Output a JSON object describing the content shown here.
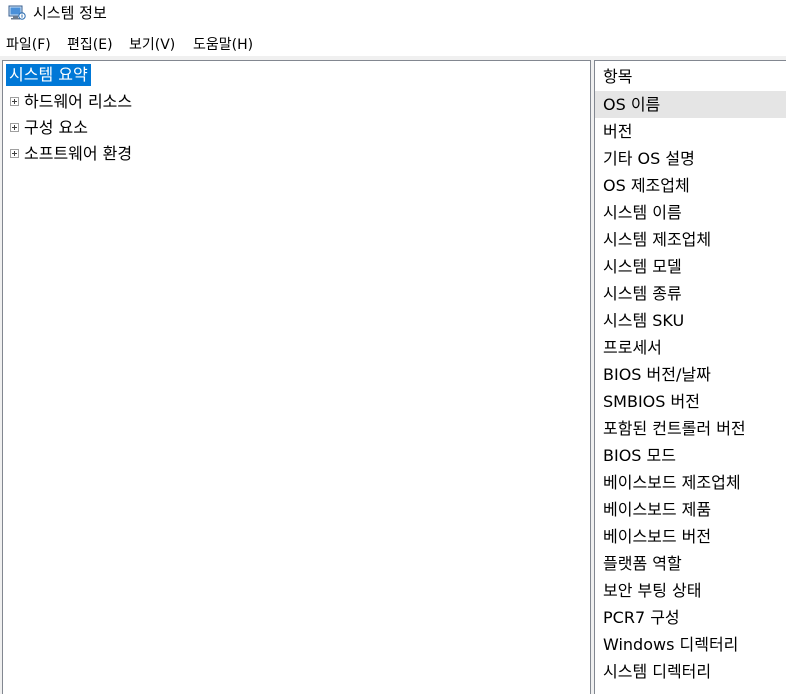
{
  "window": {
    "title": "시스템 정보"
  },
  "menu": {
    "items": [
      "파일(F)",
      "편집(E)",
      "보기(V)",
      "도움말(H)"
    ]
  },
  "tree": {
    "root": "시스템 요약",
    "children": [
      "하드웨어 리소스",
      "구성 요소",
      "소프트웨어 환경"
    ]
  },
  "list": {
    "header": "항목",
    "selected_index": 0,
    "rows": [
      "OS 이름",
      "버전",
      "기타 OS 설명",
      "OS 제조업체",
      "시스템 이름",
      "시스템 제조업체",
      "시스템 모델",
      "시스템 종류",
      "시스템 SKU",
      "프로세서",
      "BIOS 버전/날짜",
      "SMBIOS 버전",
      "포함된 컨트롤러 버전",
      "BIOS 모드",
      "베이스보드 제조업체",
      "베이스보드 제품",
      "베이스보드 버전",
      "플랫폼 역할",
      "보안 부팅 상태",
      "PCR7 구성",
      "Windows 디렉터리",
      "시스템 디렉터리"
    ]
  }
}
